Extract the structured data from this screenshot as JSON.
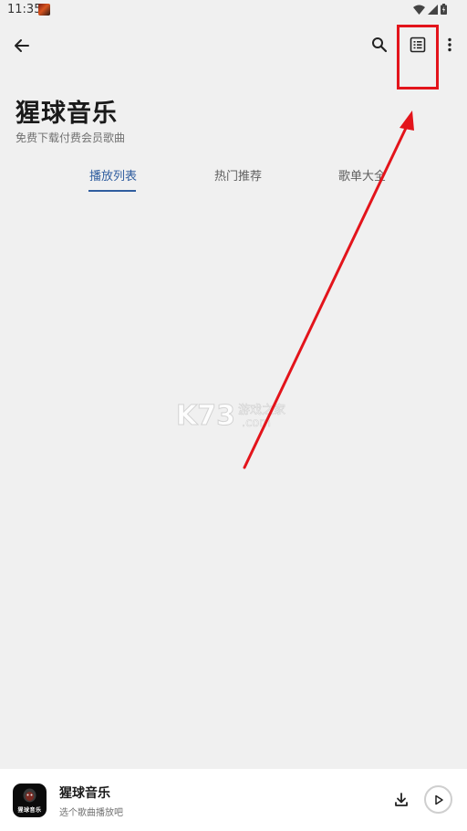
{
  "status_bar": {
    "time": "11:35"
  },
  "header": {
    "title": "猩球音乐",
    "subtitle": "免费下载付费会员歌曲"
  },
  "tabs": [
    {
      "label": "播放列表",
      "active": true
    },
    {
      "label": "热门推荐",
      "active": false
    },
    {
      "label": "歌单大全",
      "active": false
    }
  ],
  "watermark": {
    "brand": "K73",
    "line1": "游戏之家",
    "line2": ".com"
  },
  "player": {
    "title": "猩球音乐",
    "subtitle": "选个歌曲播放吧",
    "album_art_text": "猩球音乐"
  },
  "colors": {
    "accent": "#2f5d9f",
    "annotation_red": "#e3141b",
    "background": "#f0f0f0"
  },
  "icons": [
    "back-arrow-icon",
    "search-icon",
    "playlist-icon",
    "more-vert-icon",
    "download-icon",
    "play-icon"
  ]
}
